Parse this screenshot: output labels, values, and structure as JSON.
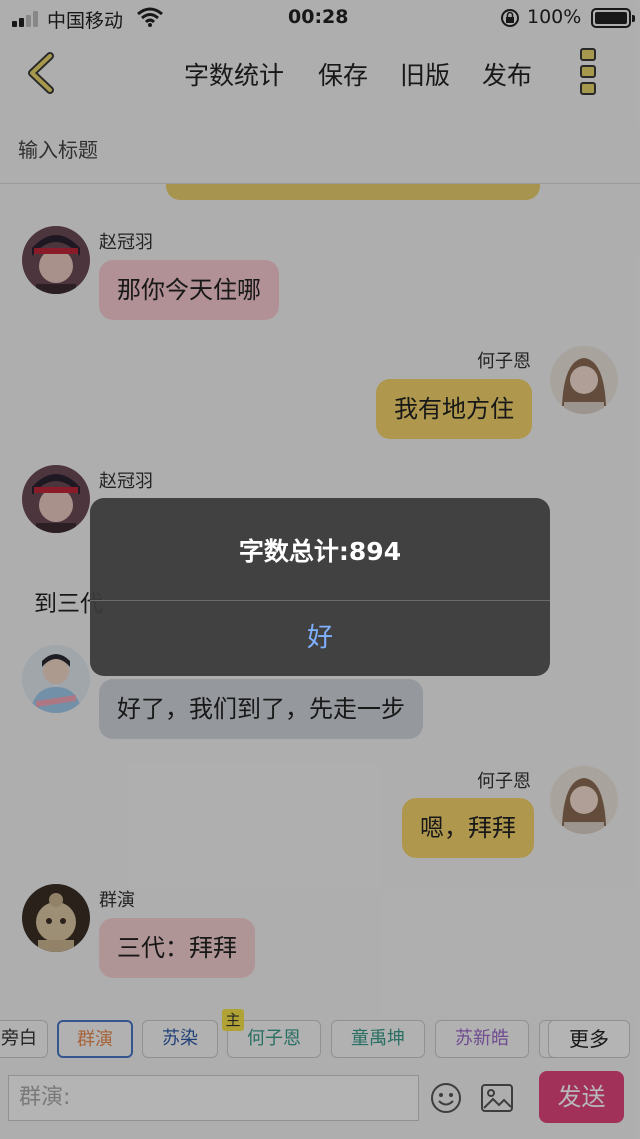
{
  "status_bar": {
    "carrier": "中国移动",
    "time": "00:28",
    "battery": "100%"
  },
  "nav": {
    "actions": [
      "字数统计",
      "保存",
      "旧版",
      "发布"
    ]
  },
  "title_input": {
    "placeholder": "输入标题"
  },
  "messages": [
    {
      "speaker": "赵冠羽",
      "text": "那你今天住哪"
    },
    {
      "speaker": "何子恩",
      "text": "我有地方住"
    },
    {
      "speaker": "赵冠羽",
      "text": ""
    },
    {
      "narration": "到三代"
    },
    {
      "speaker": "",
      "text": "好了，我们到了，先走一步"
    },
    {
      "speaker": "何子恩",
      "text": "嗯，拜拜"
    },
    {
      "speaker": "群演",
      "text": "三代：拜拜"
    }
  ],
  "roles": [
    {
      "label": "旁白",
      "color": "#333333"
    },
    {
      "label": "群演",
      "color": "#e8894f"
    },
    {
      "label": "苏染",
      "color": "#2f5aa8"
    },
    {
      "label": "何子恩",
      "color": "#3a9a8a",
      "badge": "主"
    },
    {
      "label": "童禹坤",
      "color": "#3a9a8a"
    },
    {
      "label": "苏新皓",
      "color": "#9b6ac8"
    },
    {
      "label": "",
      "color": "#333333"
    },
    {
      "label": "更多",
      "color": "#222222"
    }
  ],
  "input": {
    "placeholder": "群演:",
    "send_label": "发送"
  },
  "alert": {
    "title": "字数总计:894",
    "ok_label": "好"
  },
  "colors": {
    "send_button": "#e0457c",
    "bubble_pink": "#f5c9d0",
    "bubble_yellow": "#f3d36b",
    "bubble_grey": "#cfd3da",
    "alert_ok": "#7fb1ff"
  }
}
